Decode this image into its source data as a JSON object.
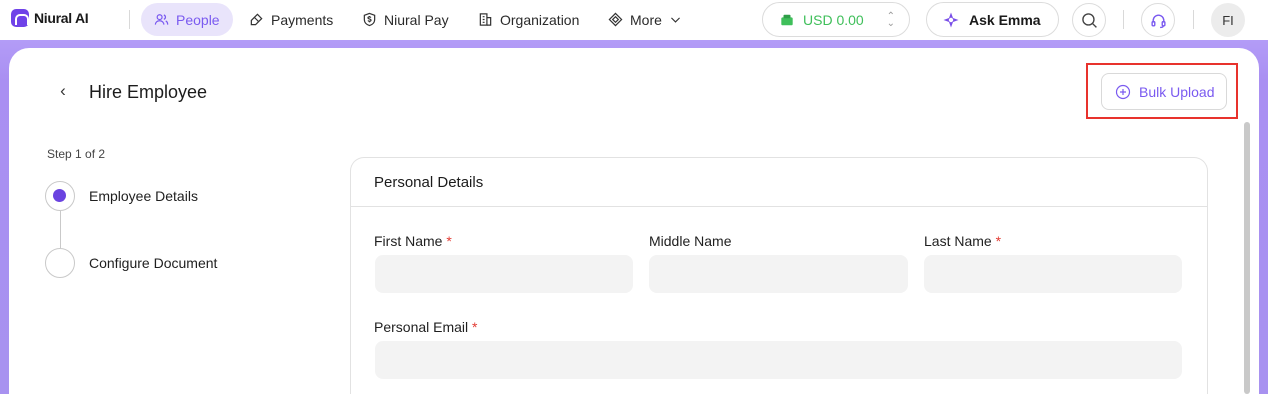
{
  "brand": {
    "name": "Niural AI"
  },
  "nav": {
    "items": [
      {
        "label": "People",
        "icon": "people-icon",
        "active": true
      },
      {
        "label": "Payments",
        "icon": "payments-icon",
        "active": false
      },
      {
        "label": "Niural Pay",
        "icon": "niural-pay-icon",
        "active": false
      },
      {
        "label": "Organization",
        "icon": "organization-icon",
        "active": false
      },
      {
        "label": "More",
        "icon": "more-icon",
        "active": false
      }
    ]
  },
  "balance": {
    "label": "USD 0.00",
    "color": "#3fbf5a"
  },
  "assistant": {
    "label": "Ask Emma"
  },
  "user": {
    "initials": "FI"
  },
  "page": {
    "title": "Hire Employee",
    "bulk_upload_label": "Bulk Upload"
  },
  "stepper": {
    "counter": "Step 1 of 2",
    "steps": [
      {
        "label": "Employee Details",
        "active": true
      },
      {
        "label": "Configure Document",
        "active": false
      }
    ]
  },
  "form": {
    "section_title": "Personal Details",
    "fields": {
      "first_name": {
        "label": "First Name",
        "required": true,
        "value": ""
      },
      "middle_name": {
        "label": "Middle Name",
        "required": false,
        "value": ""
      },
      "last_name": {
        "label": "Last Name",
        "required": true,
        "value": ""
      },
      "personal_email": {
        "label": "Personal Email",
        "required": true,
        "value": ""
      }
    },
    "required_marker": "*"
  },
  "colors": {
    "accent": "#7a5af0",
    "step_active": "#6a43e0",
    "highlight_box": "#e8322d",
    "band": "#a98ff2"
  }
}
